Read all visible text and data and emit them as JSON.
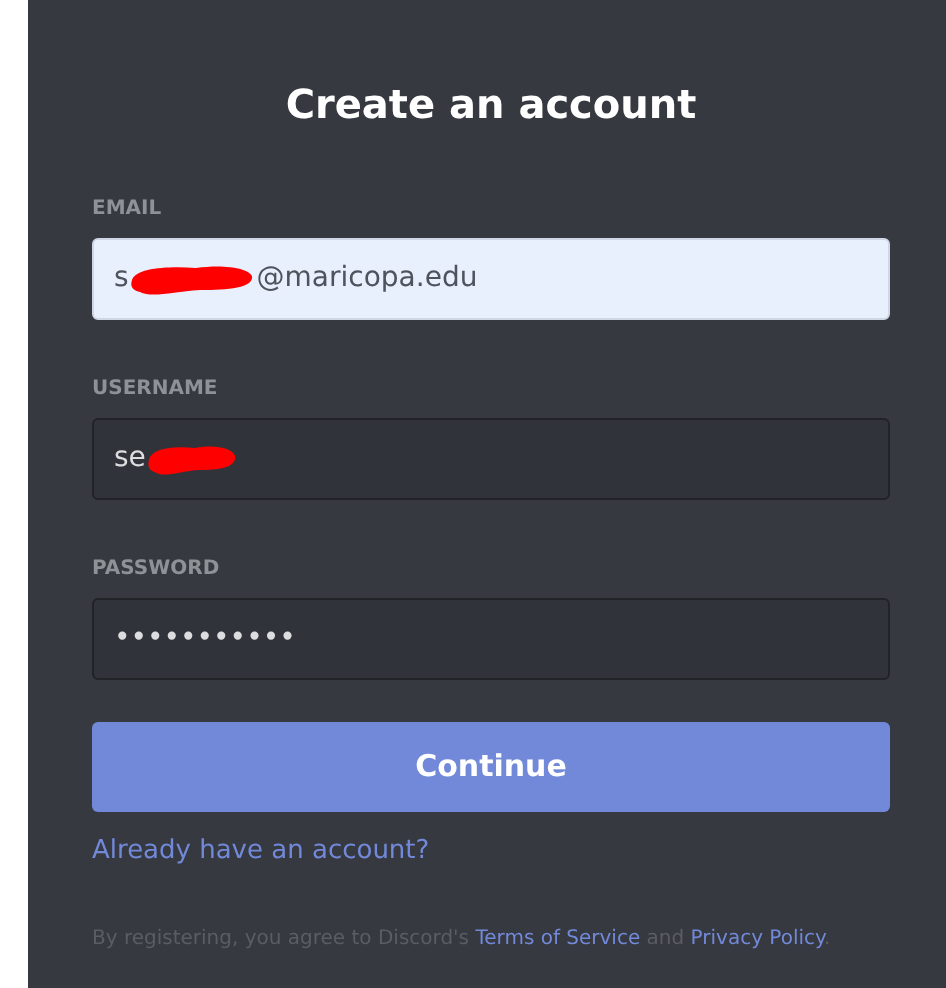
{
  "title": "Create an account",
  "fields": [
    {
      "label": "EMAIL",
      "value_start": "s",
      "redacted": true,
      "value_end": "@maricopa.edu",
      "autofilled": true
    },
    {
      "label": "USERNAME",
      "value_start": "se",
      "redacted": true,
      "autofilled": false
    },
    {
      "label": "PASSWORD",
      "value_start": "•••••••••••",
      "redacted": false,
      "autofilled": false
    }
  ],
  "continue_button": "Continue",
  "login_link": "Already have an account?",
  "terms": {
    "before": "By registering, you agree to Discord's ",
    "terms_link": "Terms of Service",
    "middle": " and ",
    "privacy_link": "Privacy Policy",
    "after": "."
  }
}
